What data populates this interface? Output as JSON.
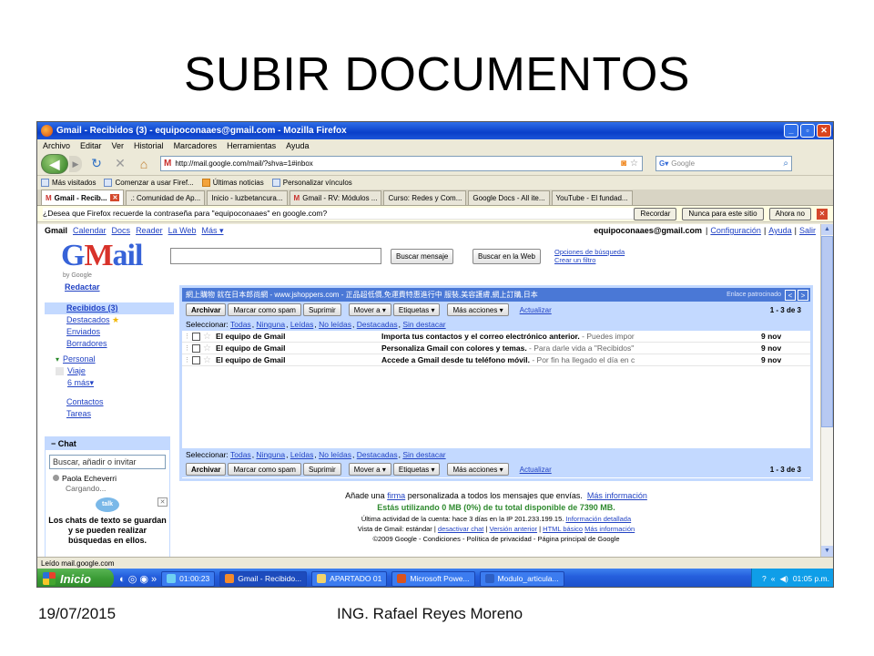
{
  "slide": {
    "title": "SUBIR DOCUMENTOS",
    "footer_date": "19/07/2015",
    "footer_author": "ING. Rafael Reyes Moreno"
  },
  "window": {
    "title": "Gmail - Recibidos (3) - equipoconaaes@gmail.com - Mozilla Firefox"
  },
  "menubar": [
    "Archivo",
    "Editar",
    "Ver",
    "Historial",
    "Marcadores",
    "Herramientas",
    "Ayuda"
  ],
  "navbar": {
    "url": "http://mail.google.com/mail/?shva=1#inbox",
    "search_placeholder": "Google"
  },
  "bookmarks": [
    "Más visitados",
    "Comenzar a usar Firef...",
    "Últimas noticias",
    "Personalizar vínculos"
  ],
  "tabs": [
    "Gmail - Recib...",
    ".: Comunidad de Ap...",
    "Inicio - luzbetancura...",
    "Gmail - RV: Módulos ...",
    "Curso: Redes y Com...",
    "Google Docs - All ite...",
    "YouTube - El fundad..."
  ],
  "password_bar": {
    "message": "¿Desea que Firefox recuerde la contraseña para \"equipoconaaes\" en google.com?",
    "remember": "Recordar",
    "never": "Nunca para este sitio",
    "not_now": "Ahora no"
  },
  "gmail": {
    "topnav": [
      "Gmail",
      "Calendar",
      "Docs",
      "Reader",
      "La Web",
      "Más ▾"
    ],
    "account": "equipoconaaes@gmail.com",
    "account_links": [
      "Configuración",
      "Ayuda",
      "Salir"
    ],
    "logo_by": "by Google",
    "search_mail_btn": "Buscar mensaje",
    "search_web_btn": "Buscar en la Web",
    "search_options": "Opciones de búsqueda",
    "create_filter": "Crear un filtro",
    "compose": "Redactar",
    "inbox": "Recibidos (3)",
    "starred": "Destacados",
    "sent": "Enviados",
    "drafts": "Borradores",
    "labels": [
      "Personal",
      "Viaje",
      "6 más▾"
    ],
    "label_colors": [
      "#2a8a2a",
      "#e6e6e6"
    ],
    "contacts": "Contactos",
    "tasks": "Tareas",
    "chat_title": "Chat",
    "chat_search": "Buscar, añadir o invitar",
    "chat_contact": "Paola Echeverri",
    "chat_status": "Cargando...",
    "talk_label": "talk",
    "talk_text": "Los chats de texto se guardan y se pueden realizar búsquedas en ellos.",
    "ad_text": "網上購物 就在日本郎尚網 - www.jshoppers.com - 正品超低價,免運費特惠進行中 服裝,美容護膚,網上訂購,日本",
    "ad_sponsor": "Enlace patrocinado",
    "buttons": {
      "archive": "Archivar",
      "spam": "Marcar como spam",
      "delete": "Suprimir",
      "move": "Mover a ▾",
      "labels": "Etiquetas ▾",
      "more": "Más acciones ▾",
      "refresh": "Actualizar"
    },
    "count": "1 - 3 de 3",
    "select_label": "Seleccionar:",
    "select_options": [
      "Todas",
      "Ninguna",
      "Leídas",
      "No leídas",
      "Destacadas",
      "Sin destacar"
    ],
    "messages": [
      {
        "sender": "El equipo de Gmail",
        "subject": "Importa tus contactos y el correo electrónico anterior.",
        "snippet": " - Puedes impor",
        "date": "9 nov"
      },
      {
        "sender": "El equipo de Gmail",
        "subject": "Personaliza Gmail con colores y temas.",
        "snippet": " - Para darle vida a \"Recibidos\"",
        "date": "9 nov"
      },
      {
        "sender": "El equipo de Gmail",
        "subject": "Accede a Gmail desde tu teléfono móvil.",
        "snippet": " - Por fin ha llegado el día en c",
        "date": "9 nov"
      }
    ],
    "footer": {
      "sig_pre": "Añade una",
      "sig_link": "firma",
      "sig_post": "personalizada a todos los mensajes que envías.",
      "more_info": "Más información",
      "quota": "Estás utilizando 0 MB (0%) de tu total disponible de 7390 MB.",
      "last_activity": "Última actividad de la cuenta: hace 3 días en la IP 201.233.199.15.",
      "detail_info": "Información detallada",
      "view_label": "Vista de Gmail: estándar |",
      "disable_chat": "desactivar chat",
      "old_version": "Versión anterior",
      "basic_html": "HTML básico",
      "more_info2": "Más información",
      "copyright": "©2009 Google - Condiciones - Política de privacidad - Página principal de Google"
    }
  },
  "statusbar": "Leído mail.google.com",
  "taskbar": {
    "start": "Inicio",
    "items": [
      "01:00:23",
      "Gmail - Recibido...",
      "APARTADO 01",
      "Microsoft Powe...",
      "Modulo_articula..."
    ],
    "item_colors": [
      "#6fd0f2",
      "#f58a2a",
      "#f2d36b",
      "#d9531e",
      "#2d5fc4"
    ],
    "clock": "01:05 p.m."
  }
}
